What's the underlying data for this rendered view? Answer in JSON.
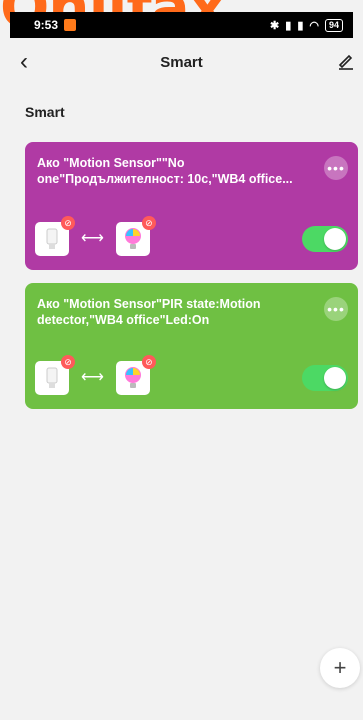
{
  "status_bar": {
    "time": "9:53",
    "battery": "94",
    "icons": [
      "bluetooth-icon",
      "signal-icon",
      "signal-icon",
      "wifi-icon",
      "battery-icon"
    ]
  },
  "header": {
    "back_icon": "chevron-left-icon",
    "title": "Smart",
    "edit_icon": "pencil-icon"
  },
  "section": {
    "title": "Smart"
  },
  "scenes": [
    {
      "color": "#b03aa4",
      "text": "Ако \"Motion Sensor\"\"No one\"Продължителност: 10с,\"WB4 office...",
      "more_icon": "more-icon",
      "enabled": true
    },
    {
      "color": "#6fc043",
      "text": "Ако \"Motion Sensor\"PIR state:Motion detector,\"WB4 office\"Led:On",
      "more_icon": "more-icon",
      "enabled": true
    }
  ],
  "colors": {
    "toggle_on": "#4cd964",
    "background": "#f2f2f2"
  },
  "fab": {
    "icon": "plus-icon"
  }
}
